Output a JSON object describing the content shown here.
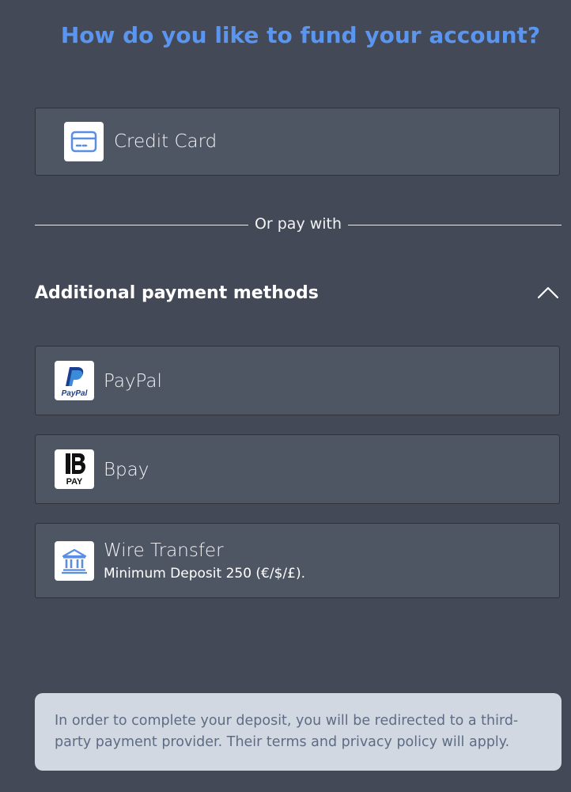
{
  "page": {
    "title": "How do you like to fund your account?"
  },
  "primary_method": {
    "label": "Credit Card",
    "icon": "credit-card-icon"
  },
  "divider": {
    "text": "Or pay with"
  },
  "additional": {
    "heading": "Additional payment methods",
    "toggle_icon": "chevron-up-icon",
    "methods": [
      {
        "label": "PayPal",
        "icon": "paypal-logo",
        "logo_text": "PayPal"
      },
      {
        "label": "Bpay",
        "icon": "bpay-logo",
        "logo_text": "PAY"
      },
      {
        "label": "Wire Transfer",
        "icon": "bank-icon",
        "sublabel": "Minimum Deposit 250 (€/$/£)."
      }
    ]
  },
  "notice": {
    "text": "In order to complete your deposit, you will be redirected to a third-party payment provider. Their terms and privacy policy will apply."
  },
  "colors": {
    "background": "#434956",
    "card": "#4e5563",
    "title": "#5a95f0",
    "notice_bg": "#d2d8e2",
    "notice_text": "#5d6c84"
  }
}
